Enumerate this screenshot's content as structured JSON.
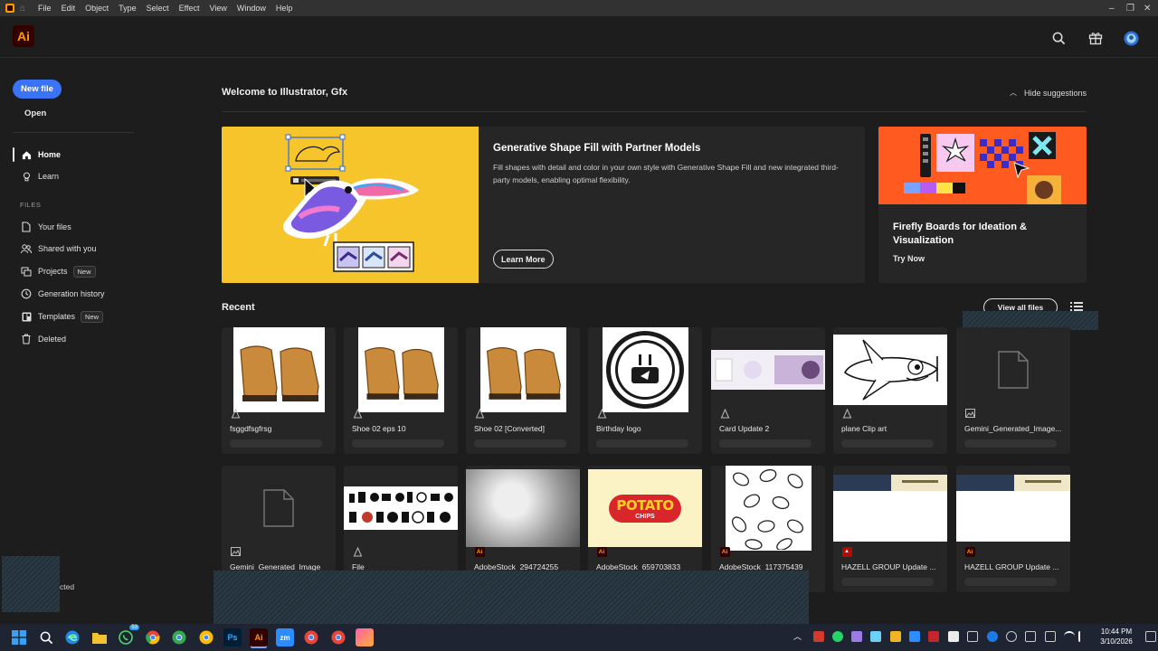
{
  "menubar": {
    "items": [
      "File",
      "Edit",
      "Object",
      "Type",
      "Select",
      "Effect",
      "View",
      "Window",
      "Help"
    ]
  },
  "header": {
    "app_logo": "Ai",
    "icons": [
      "search-icon",
      "gift-icon",
      "avatar"
    ]
  },
  "sidebar": {
    "new_file": "New file",
    "open": "Open",
    "nav": [
      {
        "label": "Home",
        "icon": "home-icon",
        "active": true
      },
      {
        "label": "Learn",
        "icon": "lightbulb-icon"
      }
    ],
    "files_section": "FILES",
    "files_nav": [
      {
        "label": "Your files",
        "icon": "file-icon"
      },
      {
        "label": "Shared with you",
        "icon": "people-icon"
      },
      {
        "label": "Projects",
        "icon": "projects-icon",
        "badge": "New"
      },
      {
        "label": "Generation history",
        "icon": "history-icon"
      },
      {
        "label": "Templates",
        "icon": "templates-icon",
        "badge": "New"
      },
      {
        "label": "Deleted",
        "icon": "trash-icon"
      }
    ],
    "footer_text": "cted"
  },
  "main": {
    "welcome": "Welcome to Illustrator, Gfx",
    "hide_suggestions": "Hide suggestions",
    "promo": {
      "title": "Generative Shape Fill with Partner Models",
      "description": "Fill shapes with detail and color in your own style with Generative Shape Fill and new integrated third-party models, enabling optimal flexibility.",
      "button": "Learn More"
    },
    "firefly": {
      "title": "Firefly Boards for Ideation & Visualization",
      "action": "Try Now"
    },
    "recent_title": "Recent",
    "view_all": "View all files",
    "files_row1": [
      {
        "name": "fsggdfsgfrsg",
        "type": "vector",
        "thumb": "boot"
      },
      {
        "name": "Shoe 02 eps 10",
        "type": "vector",
        "thumb": "boot"
      },
      {
        "name": "Shoe 02 [Converted]",
        "type": "vector",
        "thumb": "boot"
      },
      {
        "name": "Birthday logo",
        "type": "vector",
        "thumb": "badge"
      },
      {
        "name": "Card Update 2",
        "type": "vector",
        "thumb": "card"
      },
      {
        "name": "plane Clip art",
        "type": "vector",
        "thumb": "plane"
      },
      {
        "name": "Gemini_Generated_Image...",
        "type": "image",
        "thumb": "doc"
      }
    ],
    "files_row2": [
      {
        "name": "Gemini_Generated_Image",
        "type": "image",
        "thumb": "doc"
      },
      {
        "name": "File",
        "type": "vector",
        "thumb": "icons"
      },
      {
        "name": "AdobeStock_294724255",
        "type": "ai",
        "thumb": "grunge"
      },
      {
        "name": "AdobeStock_659703833",
        "type": "ai",
        "thumb": "potato"
      },
      {
        "name": "AdobeStock_117375439",
        "type": "ai",
        "thumb": "pattern"
      },
      {
        "name": "HAZELL GROUP Update ...",
        "type": "pdf",
        "thumb": "letter"
      },
      {
        "name": "HAZELL GROUP Update ...",
        "type": "ai",
        "thumb": "letter"
      }
    ],
    "potato_text": "POTATO",
    "chips_text": "CHIPS"
  },
  "taskbar": {
    "time": "10:44 PM",
    "date": "3/10/2026",
    "whatsapp_badge": "53",
    "ps_label": "Ps",
    "ai_label": "Ai",
    "zoom_label": "zm"
  },
  "colors": {
    "accent_blue": "#3a73f5",
    "ai_orange": "#ff9a00",
    "promo_yellow": "#f6c52c",
    "firefly_orange": "#ff5a1f"
  }
}
